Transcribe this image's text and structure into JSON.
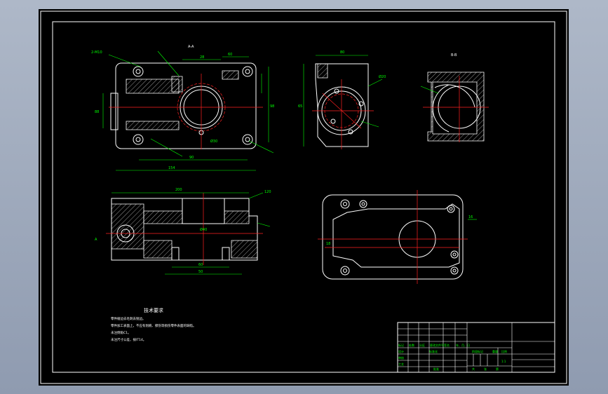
{
  "drawing": {
    "section_labels": [
      "A-A",
      "B-B"
    ],
    "tech_requirements_title": "技术要求",
    "tech_requirements": [
      "零件棱边去毛刺去锐边。",
      "零件加工表面上，不应有划痕、擦伤等损伤零件表面的缺陷。",
      "未注倒角C1。",
      "未注尺寸公差，按IT14。"
    ],
    "dims_front": [
      "98",
      "60",
      "28",
      "165",
      "154",
      "90",
      "88",
      "2-M10",
      "Ø30"
    ],
    "dims_side": [
      "80",
      "65",
      "Ø20"
    ],
    "dims_bottom": [
      "200",
      "Ø40",
      "60",
      "50",
      "120"
    ],
    "dims_top": [
      "16",
      "18",
      "A"
    ],
    "title_block": {
      "row_labels": [
        "标记",
        "处数",
        "分区",
        "更改文件号",
        "签名",
        "年、月、日"
      ],
      "designer": "设计",
      "standardization": "标准化",
      "stage_mark": "阶段标记",
      "weight": "重量",
      "scale": "比例",
      "scale_value": "1:1",
      "sheet_total": "共",
      "sheet_label": "张",
      "sheet_no": "第",
      "reviewer": "审核",
      "process": "工艺",
      "approve": "批准"
    }
  }
}
